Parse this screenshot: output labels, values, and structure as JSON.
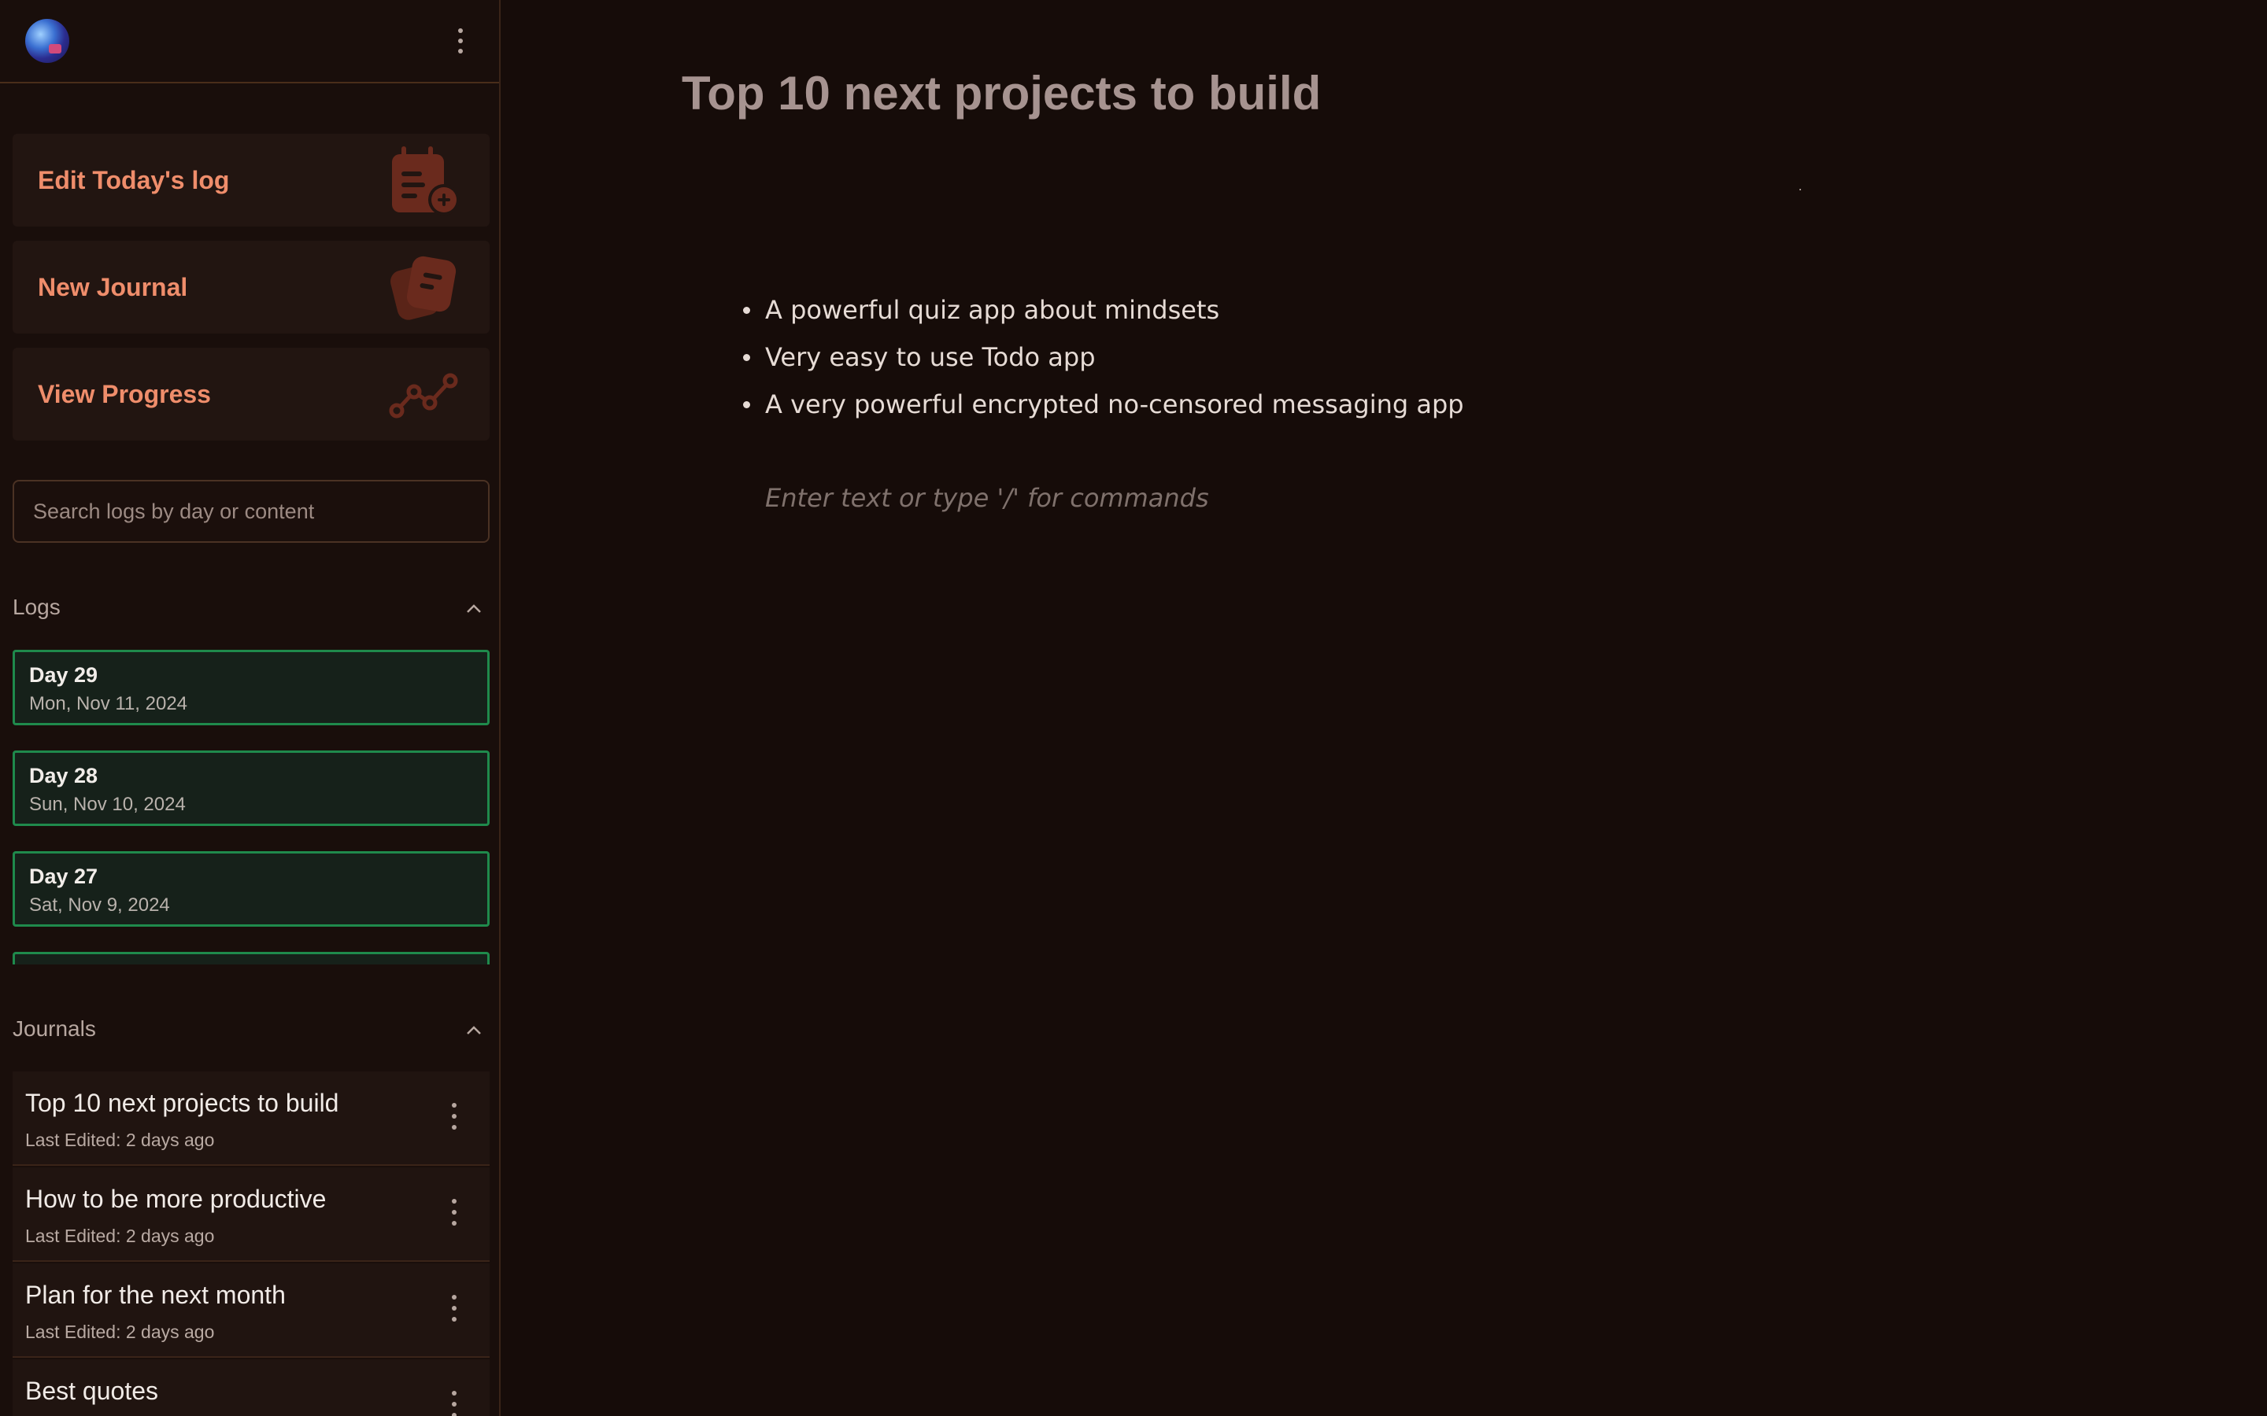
{
  "sidebar": {
    "actions": [
      {
        "label": "Edit Today's log",
        "icon": "calendar-add-icon"
      },
      {
        "label": "New Journal",
        "icon": "notes-icon"
      },
      {
        "label": "View Progress",
        "icon": "trend-line-icon"
      }
    ],
    "search": {
      "placeholder": "Search logs by day or content",
      "value": ""
    },
    "logs": {
      "title": "Logs",
      "items": [
        {
          "day": "Day 29",
          "date": "Mon, Nov 11, 2024"
        },
        {
          "day": "Day 28",
          "date": "Sun, Nov 10, 2024"
        },
        {
          "day": "Day 27",
          "date": "Sat, Nov 9, 2024"
        }
      ]
    },
    "journals": {
      "title": "Journals",
      "items": [
        {
          "title": "Top 10 next projects to build",
          "edited": "Last Edited: 2 days ago"
        },
        {
          "title": "How to be more productive",
          "edited": "Last Edited: 2 days ago"
        },
        {
          "title": "Plan for the next month",
          "edited": "Last Edited: 2 days ago"
        },
        {
          "title": "Best quotes",
          "edited": ""
        }
      ]
    }
  },
  "main": {
    "title": "Top 10 next projects to build",
    "bullets": [
      "A powerful quiz app about mindsets",
      "Very easy to use Todo app",
      "A very powerful encrypted no-censored messaging app"
    ],
    "editor_placeholder": "Enter text or type '/' for commands"
  },
  "colors": {
    "background": "#160c09",
    "accent": "#ef8d6b",
    "log_border": "#1f8a4c"
  }
}
